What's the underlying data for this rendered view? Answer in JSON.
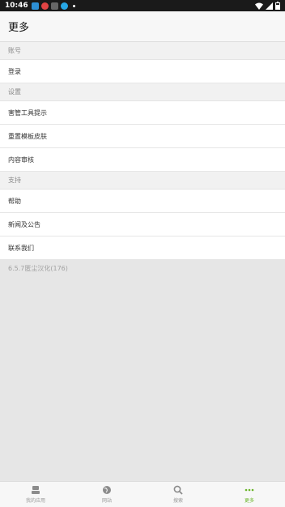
{
  "status_bar": {
    "time": "10:46"
  },
  "header": {
    "title": "更多"
  },
  "sections": [
    {
      "label": "账号",
      "items": [
        "登录"
      ]
    },
    {
      "label": "设置",
      "items": [
        "害管工具提示",
        "重置模板皮肤",
        "内容审核"
      ]
    },
    {
      "label": "支持",
      "items": [
        "帮助",
        "新闻及公告",
        "联系我们"
      ]
    }
  ],
  "version": "6.5.7匿尘汉化(176)",
  "bottom_nav": [
    {
      "label": "我的应用",
      "icon": "apps-icon",
      "active": false
    },
    {
      "label": "网站",
      "icon": "globe-icon",
      "active": false
    },
    {
      "label": "搜索",
      "icon": "search-icon",
      "active": false
    },
    {
      "label": "更多",
      "icon": "more-icon",
      "active": true
    }
  ],
  "colors": {
    "accent": "#6bb52a",
    "status_bar": "#1a1a1a"
  }
}
